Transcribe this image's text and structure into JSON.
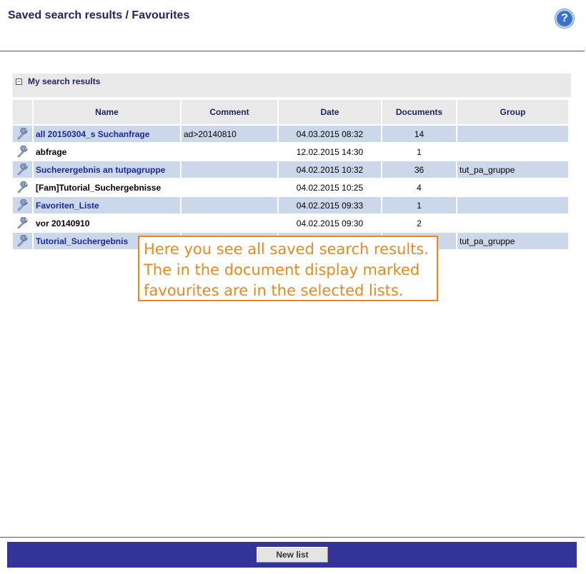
{
  "header": {
    "title": "Saved search results / Favourites",
    "help_label": "?"
  },
  "section": {
    "toggle": "−",
    "title": "My search results"
  },
  "table": {
    "columns": [
      "Name",
      "Comment",
      "Date",
      "Documents",
      "Group"
    ],
    "rows": [
      {
        "name": "all 20150304_s Suchanfrage",
        "comment": "ad>20140810",
        "date": "04.03.2015 08:32",
        "documents": "14",
        "group": ""
      },
      {
        "name": "abfrage",
        "comment": "",
        "date": "12.02.2015 14:30",
        "documents": "1",
        "group": ""
      },
      {
        "name": "Sucherergebnis an tutpagruppe",
        "comment": "",
        "date": "04.02.2015 10:32",
        "documents": "36",
        "group": "tut_pa_gruppe"
      },
      {
        "name": "[Fam]Tutorial_Suchergebnisse",
        "comment": "",
        "date": "04.02.2015 10:25",
        "documents": "4",
        "group": ""
      },
      {
        "name": "Favoriten_Liste",
        "comment": "",
        "date": "04.02.2015 09:33",
        "documents": "1",
        "group": ""
      },
      {
        "name": "vor 20140910",
        "comment": "",
        "date": "04.02.2015 09:30",
        "documents": "2",
        "group": ""
      },
      {
        "name": "Tutorial_Suchergebnis",
        "comment": "",
        "date": "",
        "documents": "",
        "group": "tut_pa_gruppe"
      }
    ]
  },
  "tooltip": {
    "lines": [
      "Here you see all saved search results.",
      "The in the document display marked",
      "favourites are in the selected lists."
    ]
  },
  "footer": {
    "new_list_label": "New list"
  },
  "colors": {
    "title": "#232361",
    "row_alt": "#cdd7ea",
    "link": "#1a2a9a",
    "footer_bar": "#33339a",
    "tooltip": "#e8891f"
  }
}
